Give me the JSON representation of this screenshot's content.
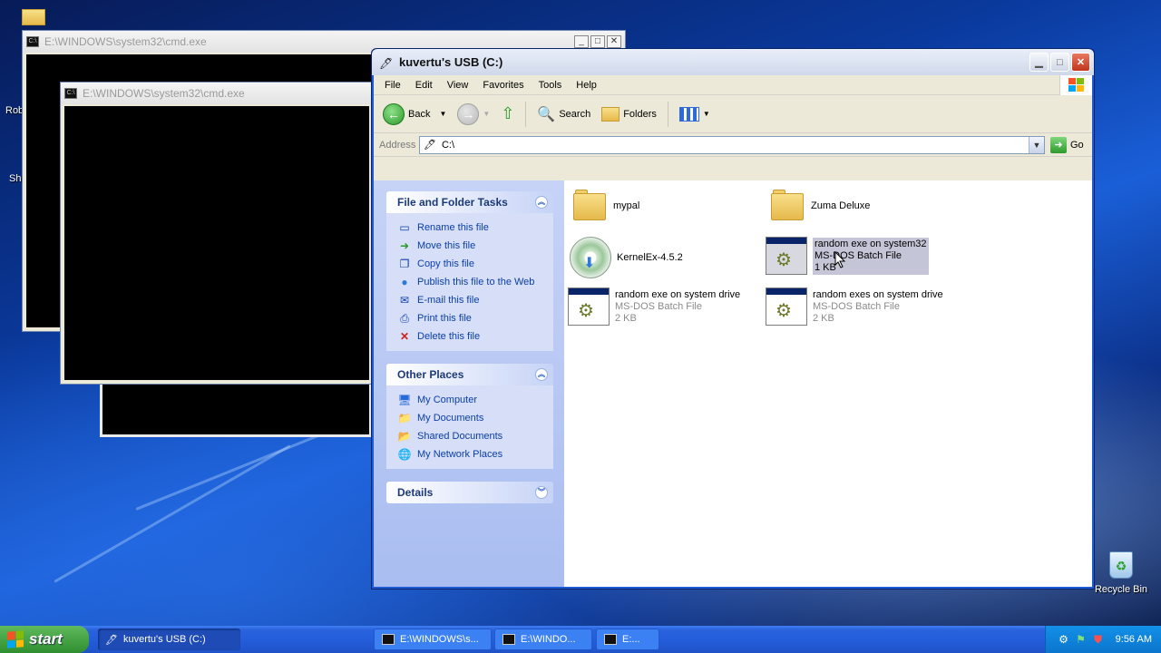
{
  "desktop": {
    "partial_labels": [
      "Rob",
      "Sh"
    ],
    "recycle_bin_label": "Recycle Bin"
  },
  "cmd_windows": [
    {
      "title": "E:\\WINDOWS\\system32\\cmd.exe"
    },
    {
      "title": "E:\\WINDOWS\\system32\\cmd.exe"
    }
  ],
  "explorer": {
    "title": "kuvertu's USB (C:)",
    "menu": [
      "File",
      "Edit",
      "View",
      "Favorites",
      "Tools",
      "Help"
    ],
    "toolbar": {
      "back_label": "Back",
      "search_label": "Search",
      "folders_label": "Folders"
    },
    "address": {
      "label": "Address",
      "value": "C:\\",
      "go_label": "Go"
    },
    "panels": {
      "file_tasks": {
        "title": "File and Folder Tasks",
        "items": [
          {
            "label": "Rename this file",
            "icon": "rename-icon"
          },
          {
            "label": "Move this file",
            "icon": "move-icon"
          },
          {
            "label": "Copy this file",
            "icon": "copy-icon"
          },
          {
            "label": "Publish this file to the Web",
            "icon": "globe-icon"
          },
          {
            "label": "E-mail this file",
            "icon": "email-icon"
          },
          {
            "label": "Print this file",
            "icon": "print-icon"
          },
          {
            "label": "Delete this file",
            "icon": "delete-icon"
          }
        ]
      },
      "other_places": {
        "title": "Other Places",
        "items": [
          {
            "label": "My Computer",
            "icon": "computer-icon"
          },
          {
            "label": "My Documents",
            "icon": "documents-icon"
          },
          {
            "label": "Shared Documents",
            "icon": "shared-folder-icon"
          },
          {
            "label": "My Network Places",
            "icon": "network-icon"
          }
        ]
      },
      "details": {
        "title": "Details"
      }
    },
    "files": [
      {
        "name": "mypal",
        "type": "",
        "size": ""
      },
      {
        "name": "Zuma Deluxe",
        "type": "",
        "size": ""
      },
      {
        "name": "KernelEx-4.5.2",
        "type": "",
        "size": ""
      },
      {
        "name": "random exe on system32",
        "type": "MS-DOS Batch File",
        "size": "1 KB"
      },
      {
        "name": "random exe on system drive",
        "type": "MS-DOS Batch File",
        "size": "2 KB"
      },
      {
        "name": "random exes on system drive",
        "type": "MS-DOS Batch File",
        "size": "2 KB"
      }
    ]
  },
  "taskbar": {
    "start_label": "start",
    "buttons": [
      {
        "label": "kuvertu's USB (C:)"
      },
      {
        "label": "E:\\WINDOWS\\s..."
      },
      {
        "label": "E:\\WINDO..."
      },
      {
        "label": "E:..."
      }
    ],
    "clock": "9:56 AM"
  }
}
